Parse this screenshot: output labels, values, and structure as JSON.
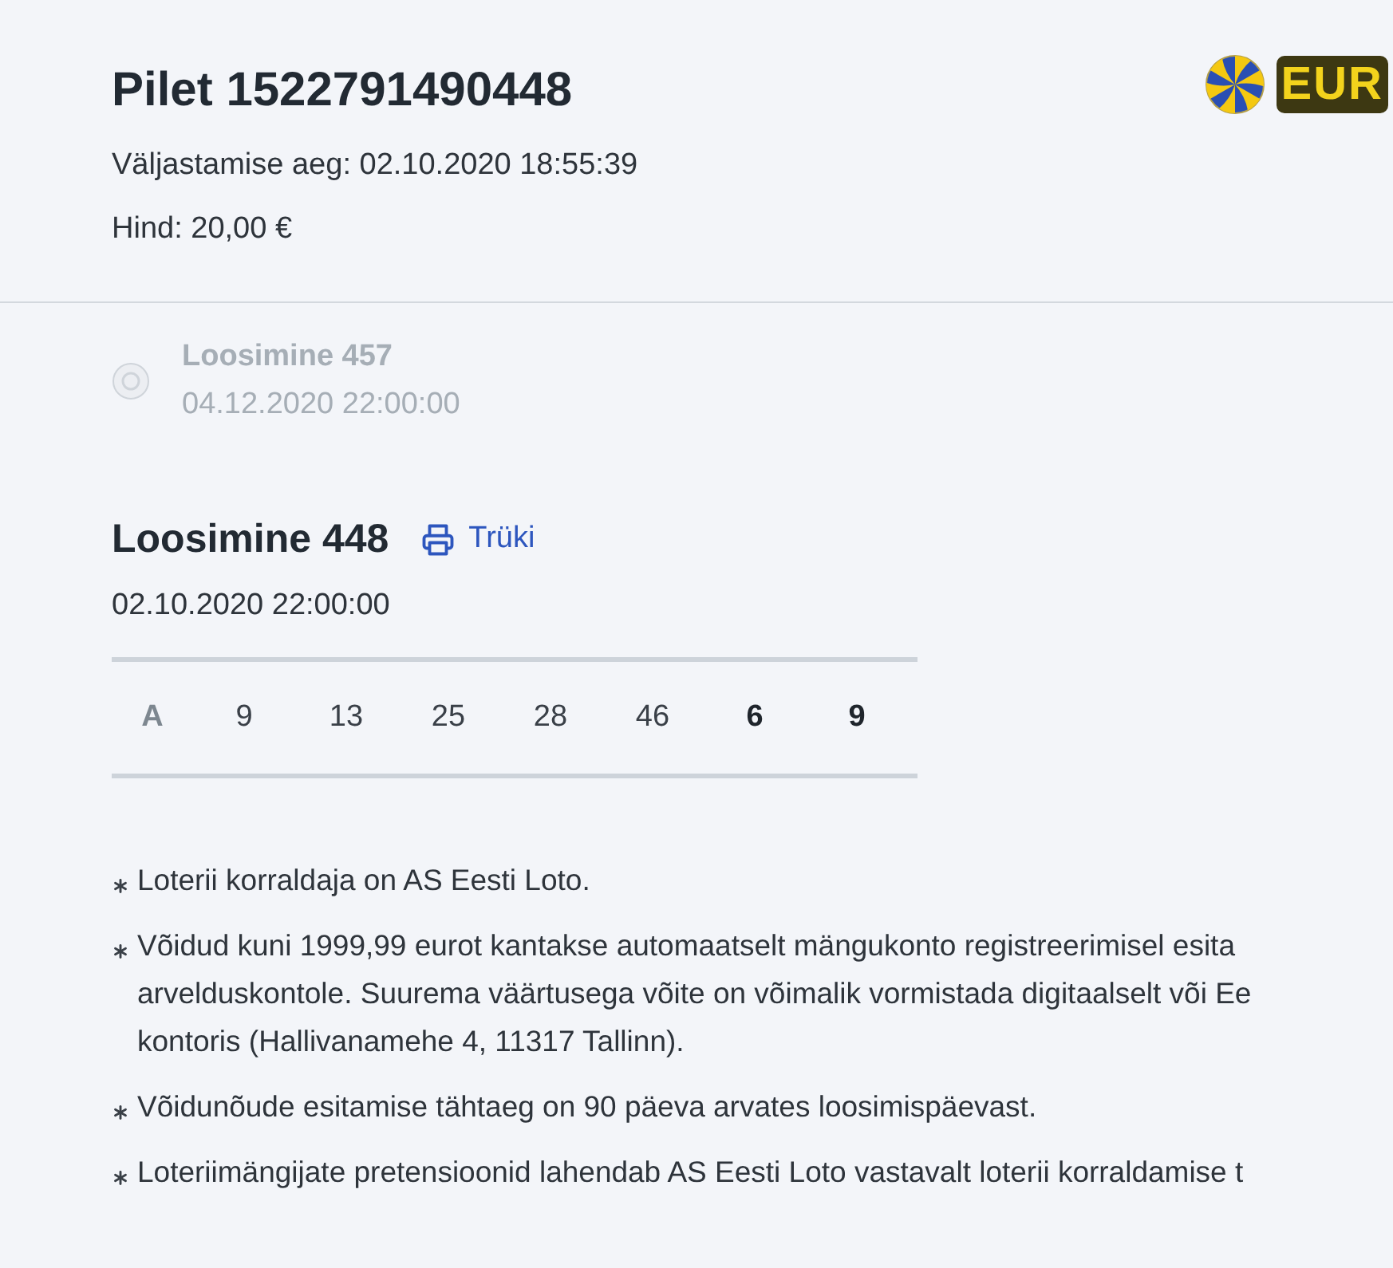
{
  "ticket": {
    "title": "Pilet 1522791490448",
    "issued": "Väljastamise aeg: 02.10.2020 18:55:39",
    "price": "Hind: 20,00 €"
  },
  "logo": {
    "text": "EUR"
  },
  "draws": [
    {
      "title": "Loosimine 457",
      "date": "04.12.2020 22:00:00",
      "selected": false,
      "disabled": true
    }
  ],
  "active_draw": {
    "title": "Loosimine 448",
    "print_link": "Trüki",
    "date": "02.10.2020 22:00:00",
    "numbers": [
      {
        "kind": "label",
        "text": "A"
      },
      {
        "kind": "main",
        "text": "9"
      },
      {
        "kind": "main",
        "text": "13"
      },
      {
        "kind": "main",
        "text": "25"
      },
      {
        "kind": "main",
        "text": "28"
      },
      {
        "kind": "main",
        "text": "46"
      },
      {
        "kind": "extra",
        "text": "6"
      },
      {
        "kind": "extra",
        "text": "9"
      }
    ]
  },
  "notes": [
    {
      "text": "Loterii korraldaja on AS Eesti Loto."
    },
    {
      "text": "Võidud kuni 1999,99 eurot kantakse automaatselt mängukonto registreerimisel esita\narvelduskontole. Suurema väärtusega võite on võimalik vormistada digitaalselt või Ee\nkontoris (Hallivanamehe 4, 11317 Tallinn)."
    },
    {
      "text": "Võidunõude esitamise tähtaeg on 90 päeva arvates loosimispäevast."
    },
    {
      "text": "Loteriimängijate pretensioonid lahendab AS Eesti Loto vastavalt loterii korraldamise t"
    }
  ]
}
